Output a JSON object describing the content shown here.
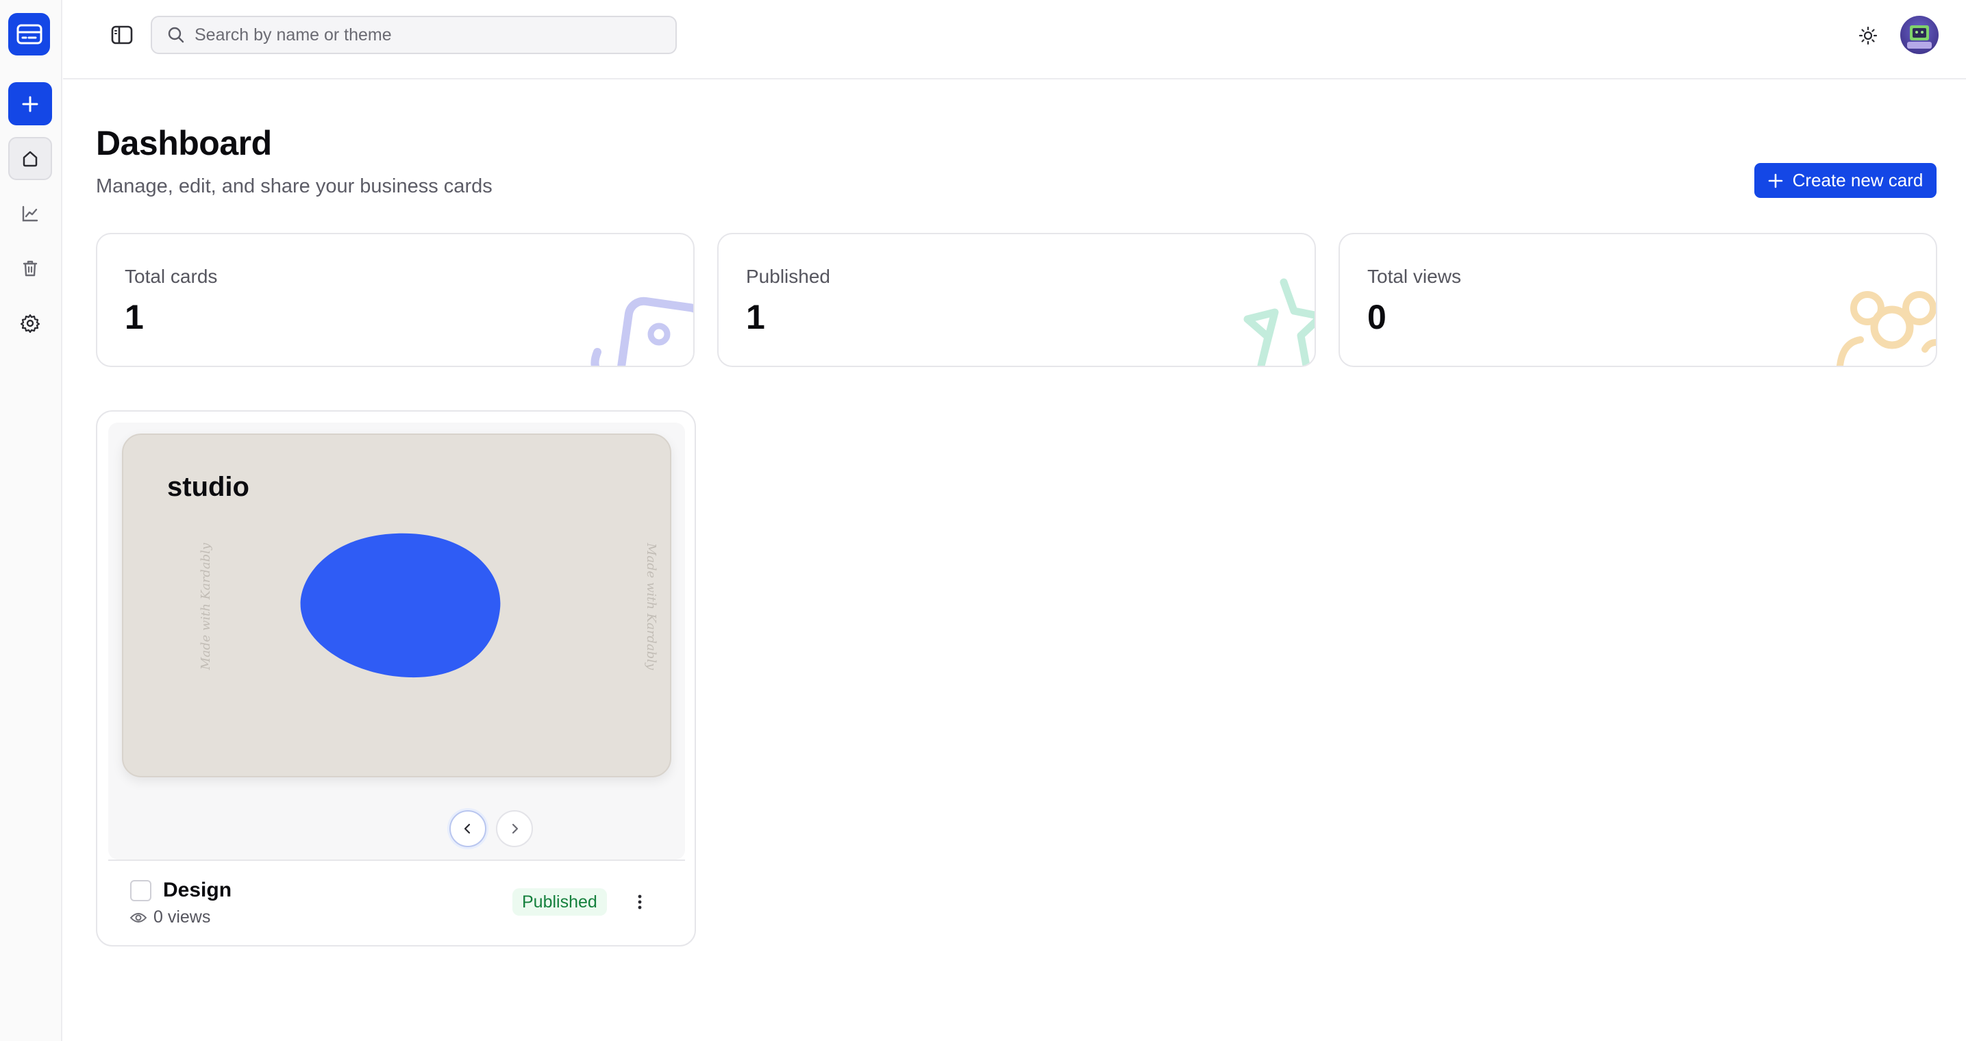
{
  "search": {
    "placeholder": "Search by name or theme"
  },
  "header": {
    "title": "Dashboard",
    "subtitle": "Manage, edit, and share your business cards",
    "create_label": "Create new card"
  },
  "stats": [
    {
      "label": "Total cards",
      "value": "1",
      "icon": "card-icon",
      "accent": "#c7c9f3"
    },
    {
      "label": "Published",
      "value": "1",
      "icon": "star-icon",
      "accent": "#c3ecdc"
    },
    {
      "label": "Total views",
      "value": "0",
      "icon": "users-icon",
      "accent": "#f6dcae"
    }
  ],
  "cards": [
    {
      "preview_name": "studio",
      "watermark": "Made with Kardably",
      "title": "Design",
      "views": "0 views",
      "status": "Published",
      "background": "#e4e0da",
      "blob_color": "#2f5cf5"
    }
  ],
  "colors": {
    "primary": "#1447e6",
    "published": "#15803d"
  },
  "sidebar": {
    "items": [
      {
        "name": "logo",
        "icon": "card-icon"
      },
      {
        "name": "add",
        "icon": "plus-icon"
      },
      {
        "name": "home",
        "icon": "home-icon",
        "active": true
      },
      {
        "name": "analytics",
        "icon": "chart-line-icon"
      },
      {
        "name": "trash",
        "icon": "trash-icon"
      },
      {
        "name": "settings",
        "icon": "gear-icon"
      }
    ]
  }
}
